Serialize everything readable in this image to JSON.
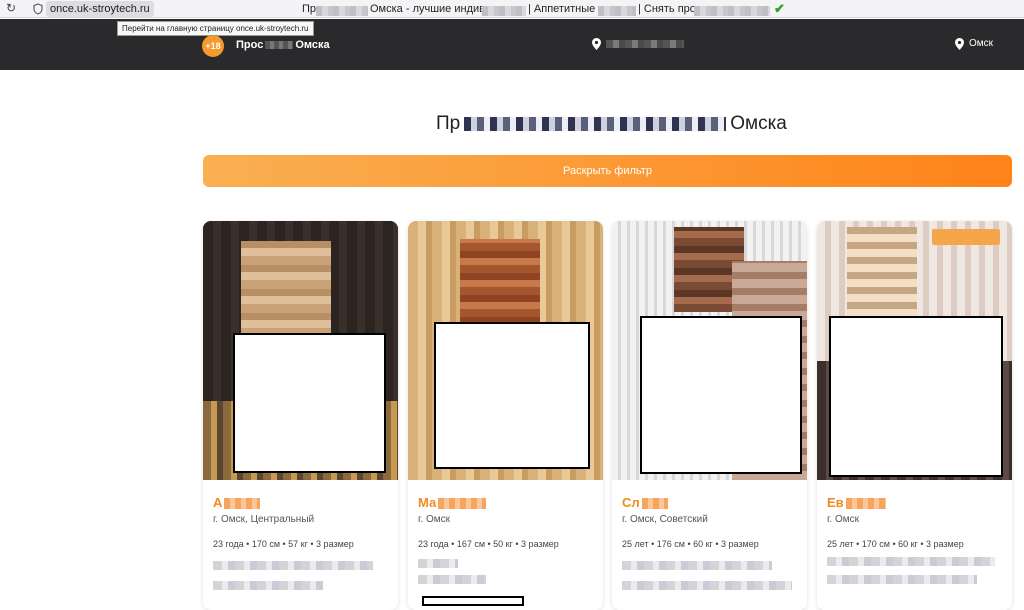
{
  "browser": {
    "url": "once.uk-stroytech.ru",
    "tab_title_parts": [
      "Пр",
      "Омска - лучшие индив",
      "| Аппетитные",
      "| Снять про"
    ],
    "tooltip": "Перейти на главную страницу once.uk-stroytech.ru",
    "icons": [
      "reload-icon",
      "shield-icon",
      "check-icon"
    ]
  },
  "header": {
    "age_badge": "+18",
    "brand_start": "Прос",
    "brand_end": "Омска",
    "city": "Омск"
  },
  "main": {
    "title_start": "Пр",
    "title_end": "Омска",
    "filter_button": "Раскрыть фильтр"
  },
  "cards": [
    {
      "name": "А",
      "location": "г. Омск, Центральный",
      "params": "23 года • 170 см • 57 кг • 3 размер"
    },
    {
      "name": "Ма",
      "location": "г. Омск",
      "params": "23 года • 167 см • 50 кг • 3 размер"
    },
    {
      "name": "Сл",
      "location": "г. Омск, Советский",
      "params": "25 лет • 176 см • 60 кг • 3 размер"
    },
    {
      "name": "Ев",
      "location": "г. Омск",
      "params": "25 лет • 170 см • 60 кг • 3 размер"
    }
  ],
  "colors": {
    "accent": "#ff8c23",
    "header_bg": "#2a2a2c",
    "name_color": "#f28a1e"
  }
}
